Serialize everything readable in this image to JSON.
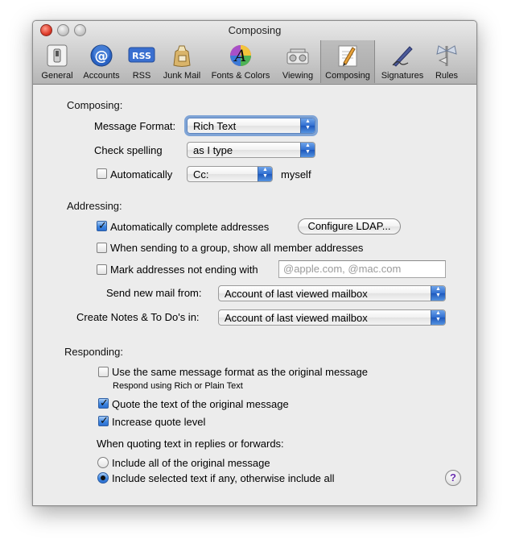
{
  "window": {
    "title": "Composing"
  },
  "toolbar": {
    "items": [
      {
        "label": "General",
        "icon": "general-switch-icon"
      },
      {
        "label": "Accounts",
        "icon": "at-sign-icon"
      },
      {
        "label": "RSS",
        "icon": "rss-icon",
        "icon_text": "RSS"
      },
      {
        "label": "Junk Mail",
        "icon": "junk-mail-bag-icon"
      },
      {
        "label": "Fonts & Colors",
        "icon": "fonts-colors-icon",
        "icon_text": "A"
      },
      {
        "label": "Viewing",
        "icon": "viewing-icon"
      },
      {
        "label": "Composing",
        "icon": "composing-pencil-icon"
      },
      {
        "label": "Signatures",
        "icon": "signature-pen-icon"
      },
      {
        "label": "Rules",
        "icon": "rules-icon"
      }
    ],
    "selected": "Composing"
  },
  "composing": {
    "header": "Composing:",
    "message_format_label": "Message Format:",
    "message_format_value": "Rich Text",
    "check_spelling_label": "Check spelling",
    "check_spelling_value": "as I type",
    "auto_label": "Automatically",
    "auto_checked": false,
    "auto_value": "Cc:",
    "myself_label": "myself"
  },
  "addressing": {
    "header": "Addressing:",
    "auto_complete_label": "Automatically complete addresses",
    "auto_complete_checked": true,
    "configure_ldap_label": "Configure LDAP...",
    "group_label": "When sending to a group, show all member addresses",
    "group_checked": false,
    "mark_label": "Mark addresses not ending with",
    "mark_checked": false,
    "mark_placeholder": "@apple.com, @mac.com",
    "send_from_label": "Send new mail from:",
    "send_from_value": "Account of last viewed mailbox",
    "notes_label": "Create Notes & To Do's in:",
    "notes_value": "Account of last viewed mailbox"
  },
  "responding": {
    "header": "Responding:",
    "same_format_label": "Use the same message format as the original message",
    "same_format_checked": false,
    "same_format_sub": "Respond using Rich or Plain Text",
    "quote_label": "Quote the text of the original message",
    "quote_checked": true,
    "increase_label": "Increase quote level",
    "increase_checked": true,
    "quoting_header": "When quoting text in replies or forwards:",
    "radio_all_label": "Include all of the original message",
    "radio_selected_label": "Include selected text if any, otherwise include all",
    "radio_selected": "selected"
  },
  "help": {
    "label": "?"
  },
  "colors": {
    "accent": "#3e86e0",
    "help_glyph": "#6a2fb0"
  }
}
